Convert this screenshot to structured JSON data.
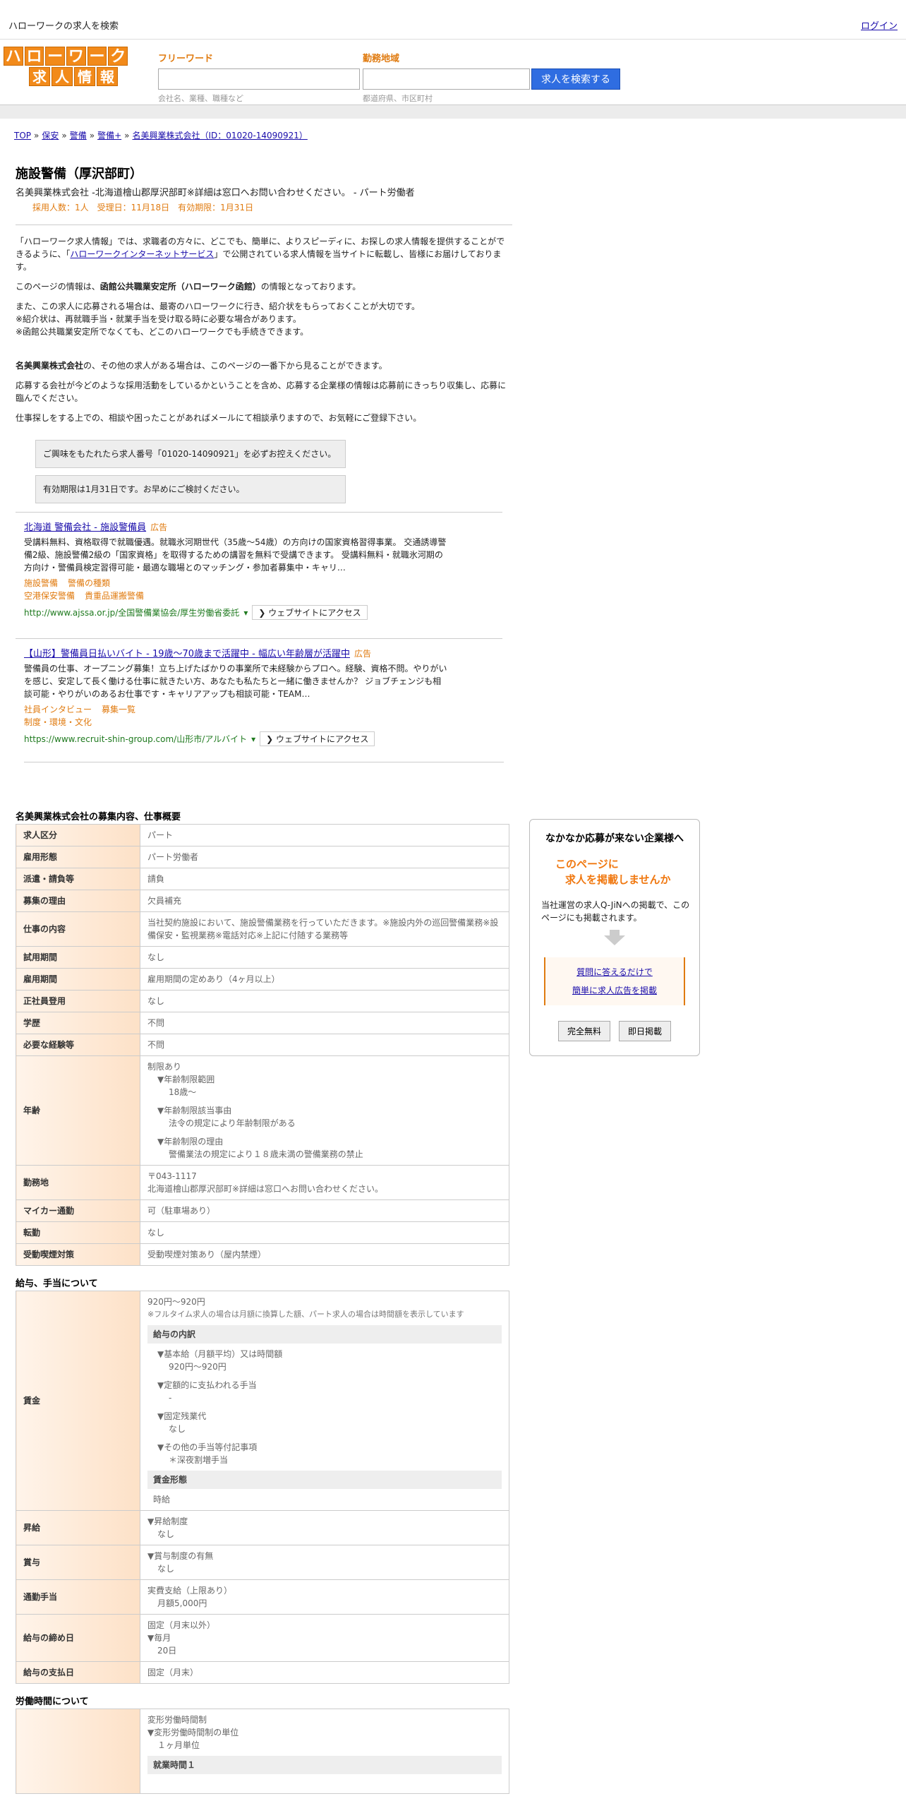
{
  "topbar": {
    "site_title": "ハローワークの求人を検索",
    "login": "ログイン"
  },
  "logo": {
    "row1": [
      "ハ",
      "ロ",
      "ー",
      "ワ",
      "ー",
      "ク"
    ],
    "row2": [
      "求",
      "人",
      "情",
      "報"
    ]
  },
  "search": {
    "freeword_label": "フリーワード",
    "freeword_hint": "会社名、業種、職種など",
    "area_label": "勤務地域",
    "area_hint": "都道府県、市区町村",
    "button": "求人を検索する"
  },
  "breadcrumb": [
    {
      "label": "TOP"
    },
    {
      "label": "保安"
    },
    {
      "label": "警備"
    },
    {
      "label": "警備+"
    },
    {
      "label": "名美興業株式会社（ID：01020-14090921）"
    }
  ],
  "job": {
    "title": "施設警備（厚沢部町）",
    "subtitle": "名美興業株式会社 -北海道檜山郡厚沢部町※詳細は窓口へお問い合わせください。 - パート労働者",
    "meta": "採用人数：1人　受理日：11月18日　有効期限：1月31日"
  },
  "intro": {
    "p1a": "「ハローワーク求人情報」では、求職者の方々に、どこでも、簡単に、よりスピーディに、お探しの求人情報を提供することができるように、「",
    "p1link": "ハローワークインターネットサービス",
    "p1b": "」で公開されている求人情報を当サイトに転載し、皆様にお届けしております。",
    "p2a": "このページの情報は、",
    "p2b": "函館公共職業安定所（ハローワーク函館）",
    "p2c": "の情報となっております。",
    "p3": "また、この求人に応募される場合は、最寄のハローワークに行き、紹介状をもらっておくことが大切です。",
    "p4": "※紹介状は、再就職手当・就業手当を受け取る時に必要な場合があります。",
    "p5": "※函館公共職業安定所でなくても、どこのハローワークでも手続きできます。",
    "p6a": "名美興業株式会社",
    "p6b": "の、その他の求人がある場合は、このページの一番下から見ることができます。",
    "p7": "応募する会社が今どのような採用活動をしているかということを含め、応募する企業様の情報は応募前にきっちり収集し、応募に臨んでください。",
    "p8": "仕事探しをする上での、相談や困ったことがあればメールにて相談承りますので、お気軽にご登録下さい。"
  },
  "notices": [
    "ご興味をもたれたら求人番号「01020-14090921」を必ずお控えください。",
    "有効期限は1月31日です。お早めにご検討ください。"
  ],
  "ads": [
    {
      "title": "北海道 警備会社 - 施設警備員",
      "badge": "広告",
      "desc": "受講料無料、資格取得で就職優遇。就職氷河期世代（35歳～54歳）の方向けの国家資格習得事業。 交通誘導警備2級、施設警備2級の「国家資格」を取得するための講習を無料で受講できます。 受講料無料・就職氷河期の方向け・警備員検定習得可能・最適な職場とのマッチング・参加者募集中・キャリ…",
      "links": [
        [
          "施設警備",
          "警備の種類"
        ],
        [
          "空港保安警備",
          "貴重品運搬警備"
        ]
      ],
      "url": "http://www.ajssa.or.jp/全国警備業協会/厚生労働省委託",
      "visit": "❯ ウェブサイトにアクセス"
    },
    {
      "title": "【山形】警備員日払いバイト - 19歳～70歳まで活躍中 - 幅広い年齢層が活躍中",
      "badge": "広告",
      "desc": "警備員の仕事、オープニング募集！立ち上げたばかりの事業所で未経験からプロへ。経験、資格不問。やりがいを感じ、安定して長く働ける仕事に就きたい方、あなたも私たちと一緒に働きませんか？ ジョブチェンジも相談可能・やりがいのあるお仕事です・キャリアアップも相談可能・TEAM…",
      "links": [
        [
          "社員インタビュー",
          "募集一覧"
        ],
        [
          "制度・環境・文化"
        ]
      ],
      "url": "https://www.recruit-shin-group.com/山形市/アルバイト",
      "visit": "❯ ウェブサイトにアクセス"
    }
  ],
  "job_table": {
    "title": "名美興業株式会社の募集内容、仕事概要",
    "rows": [
      {
        "k": "求人区分",
        "v": "パート"
      },
      {
        "k": "雇用形態",
        "v": "パート労働者"
      },
      {
        "k": "派遣・請負等",
        "v": "請負"
      },
      {
        "k": "募集の理由",
        "v": "欠員補充"
      },
      {
        "k": "仕事の内容",
        "v": "当社契約施設において、施設警備業務を行っていただきます。※施設内外の巡回警備業務※設備保安・監視業務※電話対応※上記に付随する業務等"
      },
      {
        "k": "試用期間",
        "v": "なし"
      },
      {
        "k": "雇用期間",
        "v": "雇用期間の定めあり（4ヶ月以上）"
      },
      {
        "k": "正社員登用",
        "v": "なし"
      },
      {
        "k": "学歴",
        "v": "不問"
      },
      {
        "k": "必要な経験等",
        "v": "不問"
      }
    ],
    "age": {
      "k": "年齢",
      "l1": "制限あり",
      "h1": "▼年齢制限範囲",
      "v1": "18歳～",
      "h2": "▼年齢制限該当事由",
      "v2": "法令の規定により年齢制限がある",
      "h3": "▼年齢制限の理由",
      "v3": "警備業法の規定により１８歳未満の警備業務の禁止"
    },
    "location": {
      "k": "勤務地",
      "zip": "〒043-1117",
      "addr": "北海道檜山郡厚沢部町※詳細は窓口へお問い合わせください。"
    },
    "rows2": [
      {
        "k": "マイカー通勤",
        "v": "可（駐車場あり）"
      },
      {
        "k": "転勤",
        "v": "なし"
      },
      {
        "k": "受動喫煙対策",
        "v": "受動喫煙対策あり（屋内禁煙）"
      }
    ]
  },
  "salary_table": {
    "title": "給与、手当について",
    "wage": {
      "k": "賃金",
      "range": "920円〜920円",
      "note": "※フルタイム求人の場合は月額に換算した額、パート求人の場合は時間額を表示しています",
      "breakdown_head": "給与の内訳",
      "b1h": "▼基本給（月額平均）又は時間額",
      "b1v": "920円〜920円",
      "b2h": "▼定額的に支払われる手当",
      "b2v": "-",
      "b3h": "▼固定残業代",
      "b3v": "なし",
      "b4h": "▼その他の手当等付記事項",
      "b4v": "＊深夜割増手当",
      "form_head": "賃金形態",
      "form_v": "時給"
    },
    "raise": {
      "k": "昇給",
      "h": "▼昇給制度",
      "v": "なし"
    },
    "bonus": {
      "k": "賞与",
      "h": "▼賞与制度の有無",
      "v": "なし"
    },
    "commute": {
      "k": "通勤手当",
      "l1": "実費支給（上限あり）",
      "l2": "月額5,000円"
    },
    "cutoff": {
      "k": "給与の締め日",
      "l1": "固定（月末以外）",
      "h": "▼毎月",
      "v": "20日"
    },
    "payday": {
      "k": "給与の支払日",
      "v": "固定（月末）"
    }
  },
  "work_table": {
    "title": "労働時間について",
    "l1": "変形労働時間制",
    "h1": "▼変形労働時間制の単位",
    "v1": "１ヶ月単位",
    "sub": "就業時間１"
  },
  "sidebar": {
    "title": "なかなか応募が来ない企業様へ",
    "catch1": "このページに",
    "catch2": "求人を掲載しませんか",
    "desc": "当社運営の求人Q-JiNへの掲載で、このページにも掲載されます。",
    "link1": "質問に答えるだけで",
    "link2": "簡単に求人広告を掲載",
    "btn1": "完全無料",
    "btn2": "即日掲載"
  }
}
